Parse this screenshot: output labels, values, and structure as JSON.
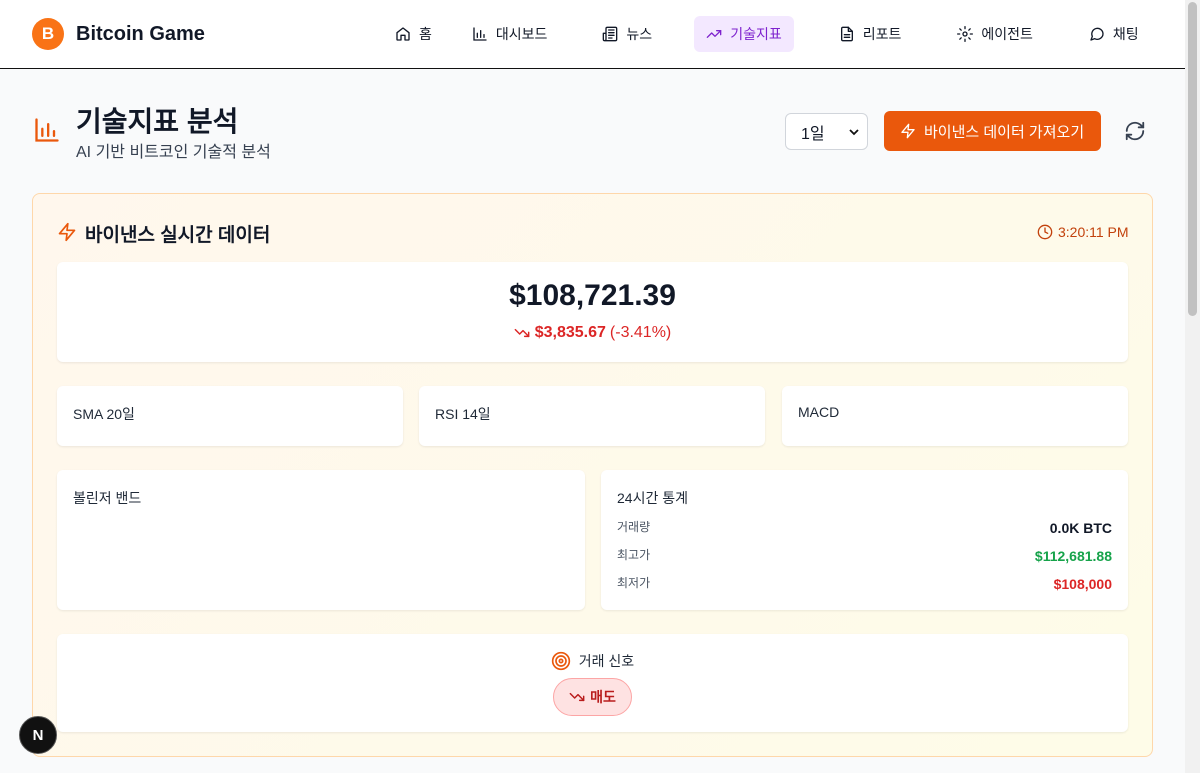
{
  "app": {
    "name": "Bitcoin Game",
    "logo_glyph": "B"
  },
  "nav": {
    "items": [
      {
        "label": "홈",
        "icon": "home-icon",
        "active": false
      },
      {
        "label": "대시보드",
        "icon": "bar-chart-icon",
        "active": false
      },
      {
        "label": "뉴스",
        "icon": "newspaper-icon",
        "active": false
      },
      {
        "label": "기술지표",
        "icon": "trending-up-icon",
        "active": true
      },
      {
        "label": "리포트",
        "icon": "file-text-icon",
        "active": false
      },
      {
        "label": "에이전트",
        "icon": "gear-icon",
        "active": false
      },
      {
        "label": "채팅",
        "icon": "chat-bubble-icon",
        "active": false
      }
    ]
  },
  "page": {
    "title": "기술지표 분석",
    "subtitle": "AI 기반 비트코인 기술적 분석",
    "period_selected": "1일",
    "fetch_label": "바이낸스 데이터 가져오기"
  },
  "live": {
    "title": "바이낸스 실시간 데이터",
    "time": "3:20:11 PM",
    "price": "$108,721.39",
    "change_abs": "$3,835.67",
    "change_pct": "(-3.41%)"
  },
  "indicators": {
    "sma": "SMA 20일",
    "rsi": "RSI 14일",
    "macd": "MACD",
    "bollinger": "볼린저 밴드"
  },
  "stats": {
    "title": "24시간 통계",
    "rows": [
      {
        "label": "거래량",
        "value": "0.0K BTC"
      },
      {
        "label": "최고가",
        "value": "$112,681.88"
      },
      {
        "label": "최저가",
        "value": "$108,000"
      }
    ]
  },
  "signal": {
    "title": "거래 신호",
    "value": "매도"
  },
  "dev_badge": "N",
  "colors": {
    "accent": "#ea580c",
    "nav_active_bg": "#f3e8ff",
    "nav_active_text": "#7e22ce",
    "negative": "#dc2626",
    "positive": "#16a34a"
  }
}
